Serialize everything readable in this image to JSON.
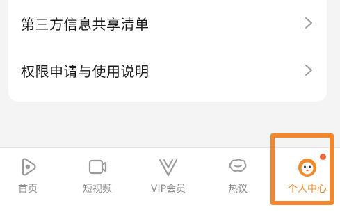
{
  "settings": {
    "items": [
      {
        "label": "第三方信息共享清单"
      },
      {
        "label": "权限申请与使用说明"
      }
    ]
  },
  "tabbar": {
    "tabs": [
      {
        "label": "首页",
        "icon": "home-play-icon",
        "active": false
      },
      {
        "label": "短视频",
        "icon": "short-video-icon",
        "active": false
      },
      {
        "label": "VIP会员",
        "icon": "vip-icon",
        "active": false
      },
      {
        "label": "热议",
        "icon": "discussion-icon",
        "active": false
      },
      {
        "label": "个人中心",
        "icon": "profile-mascot-icon",
        "active": true,
        "badge_dot": true
      }
    ]
  },
  "colors": {
    "accent": "#f08a2a",
    "highlight_frame": "#f3872e",
    "inactive_icon": "#9a9a9a",
    "badge": "#f0693a"
  }
}
